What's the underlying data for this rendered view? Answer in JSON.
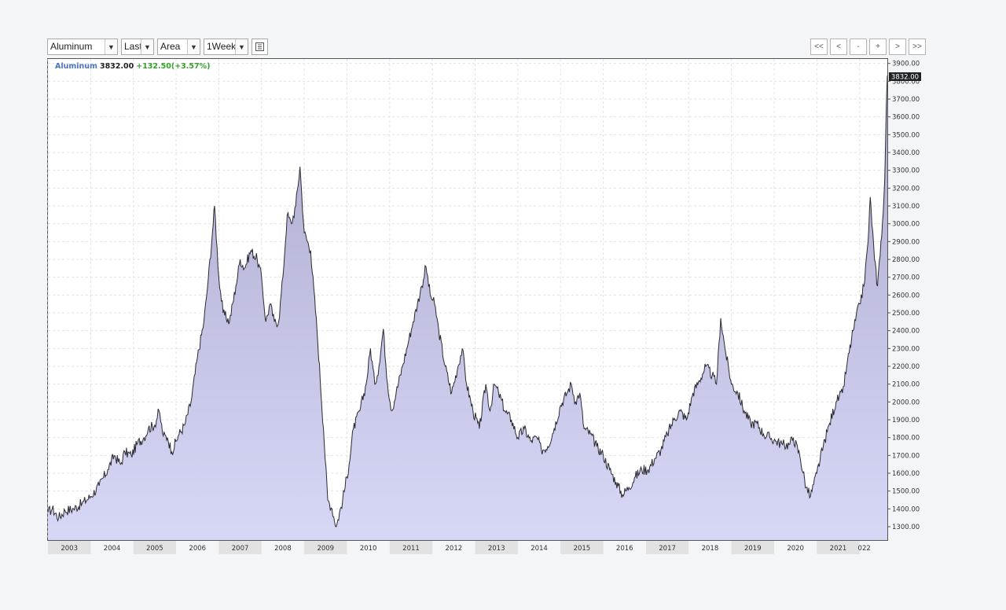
{
  "toolbar": {
    "symbol": "Aluminum",
    "price_type": "Last",
    "chart_style": "Area",
    "interval": "1Week",
    "settings_icon": "grid-settings-icon"
  },
  "navigation": {
    "first": "<<",
    "prev": "<",
    "zoom_out": "-",
    "zoom_in": "+",
    "next": ">",
    "last": ">>"
  },
  "legend": {
    "name": "Aluminum",
    "last": "3832.00",
    "change": "+132.50(+3.57%)"
  },
  "price_tag": "3832.00",
  "colors": {
    "area_top": "#abaacc",
    "area_bottom": "#d7d7f6",
    "line": "#2a2a33",
    "name": "#4a73c4",
    "change": "#33a02c",
    "grid": "#e3e3e3"
  },
  "chart_data": {
    "type": "area",
    "title": "Aluminum",
    "ylim": [
      1225,
      3925
    ],
    "yticks": [
      "1300.00",
      "1400.00",
      "1500.00",
      "1600.00",
      "1700.00",
      "1800.00",
      "1900.00",
      "2000.00",
      "2100.00",
      "2200.00",
      "2300.00",
      "2400.00",
      "2500.00",
      "2600.00",
      "2700.00",
      "2800.00",
      "2900.00",
      "3000.00",
      "3100.00",
      "3200.00",
      "3300.00",
      "3400.00",
      "3500.00",
      "3600.00",
      "3700.00",
      "3800.00",
      "3900.00"
    ],
    "xlabels": [
      "2003",
      "2004",
      "2005",
      "2006",
      "2007",
      "2008",
      "2009",
      "2010",
      "2011",
      "2012",
      "2013",
      "2014",
      "2015",
      "2016",
      "2017",
      "2018",
      "2019",
      "2020",
      "2021",
      "022"
    ],
    "xlim": [
      2002.5,
      2022.15
    ],
    "series": [
      {
        "name": "Aluminum",
        "points": [
          [
            2002.5,
            1380
          ],
          [
            2002.6,
            1400
          ],
          [
            2002.75,
            1350
          ],
          [
            2002.9,
            1390
          ],
          [
            2003.1,
            1400
          ],
          [
            2003.3,
            1430
          ],
          [
            2003.5,
            1470
          ],
          [
            2003.7,
            1530
          ],
          [
            2003.9,
            1620
          ],
          [
            2004.05,
            1700
          ],
          [
            2004.2,
            1650
          ],
          [
            2004.3,
            1720
          ],
          [
            2004.45,
            1700
          ],
          [
            2004.6,
            1770
          ],
          [
            2004.75,
            1800
          ],
          [
            2004.85,
            1850
          ],
          [
            2005.0,
            1870
          ],
          [
            2005.1,
            1950
          ],
          [
            2005.2,
            1810
          ],
          [
            2005.3,
            1800
          ],
          [
            2005.4,
            1720
          ],
          [
            2005.55,
            1810
          ],
          [
            2005.7,
            1870
          ],
          [
            2005.85,
            2000
          ],
          [
            2006.0,
            2250
          ],
          [
            2006.15,
            2450
          ],
          [
            2006.25,
            2680
          ],
          [
            2006.35,
            2950
          ],
          [
            2006.4,
            3100
          ],
          [
            2006.5,
            2700
          ],
          [
            2006.6,
            2500
          ],
          [
            2006.75,
            2450
          ],
          [
            2006.9,
            2650
          ],
          [
            2007.0,
            2800
          ],
          [
            2007.1,
            2750
          ],
          [
            2007.25,
            2850
          ],
          [
            2007.4,
            2800
          ],
          [
            2007.5,
            2700
          ],
          [
            2007.6,
            2450
          ],
          [
            2007.7,
            2550
          ],
          [
            2007.8,
            2450
          ],
          [
            2007.9,
            2450
          ],
          [
            2008.0,
            2700
          ],
          [
            2008.1,
            3050
          ],
          [
            2008.2,
            3000
          ],
          [
            2008.3,
            3100
          ],
          [
            2008.4,
            3320
          ],
          [
            2008.5,
            2950
          ],
          [
            2008.65,
            2850
          ],
          [
            2008.8,
            2400
          ],
          [
            2008.95,
            1850
          ],
          [
            2009.05,
            1450
          ],
          [
            2009.15,
            1400
          ],
          [
            2009.25,
            1300
          ],
          [
            2009.4,
            1450
          ],
          [
            2009.55,
            1650
          ],
          [
            2009.65,
            1850
          ],
          [
            2009.8,
            1950
          ],
          [
            2009.95,
            2100
          ],
          [
            2010.05,
            2300
          ],
          [
            2010.15,
            2100
          ],
          [
            2010.25,
            2200
          ],
          [
            2010.35,
            2410
          ],
          [
            2010.45,
            2100
          ],
          [
            2010.55,
            1950
          ],
          [
            2010.65,
            2050
          ],
          [
            2010.8,
            2200
          ],
          [
            2010.95,
            2350
          ],
          [
            2011.05,
            2450
          ],
          [
            2011.15,
            2550
          ],
          [
            2011.25,
            2650
          ],
          [
            2011.35,
            2760
          ],
          [
            2011.45,
            2600
          ],
          [
            2011.55,
            2550
          ],
          [
            2011.65,
            2400
          ],
          [
            2011.8,
            2200
          ],
          [
            2011.95,
            2050
          ],
          [
            2012.1,
            2200
          ],
          [
            2012.2,
            2300
          ],
          [
            2012.3,
            2100
          ],
          [
            2012.45,
            1950
          ],
          [
            2012.6,
            1850
          ],
          [
            2012.75,
            2100
          ],
          [
            2012.85,
            1950
          ],
          [
            2012.95,
            2100
          ],
          [
            2013.05,
            2050
          ],
          [
            2013.2,
            1950
          ],
          [
            2013.35,
            1900
          ],
          [
            2013.5,
            1800
          ],
          [
            2013.65,
            1850
          ],
          [
            2013.8,
            1780
          ],
          [
            2013.95,
            1800
          ],
          [
            2014.05,
            1730
          ],
          [
            2014.2,
            1750
          ],
          [
            2014.35,
            1850
          ],
          [
            2014.5,
            1980
          ],
          [
            2014.65,
            2050
          ],
          [
            2014.75,
            2100
          ],
          [
            2014.85,
            2000
          ],
          [
            2014.95,
            2050
          ],
          [
            2015.05,
            1850
          ],
          [
            2015.2,
            1820
          ],
          [
            2015.35,
            1750
          ],
          [
            2015.5,
            1700
          ],
          [
            2015.65,
            1620
          ],
          [
            2015.8,
            1550
          ],
          [
            2015.95,
            1480
          ],
          [
            2016.1,
            1520
          ],
          [
            2016.25,
            1580
          ],
          [
            2016.4,
            1620
          ],
          [
            2016.55,
            1620
          ],
          [
            2016.7,
            1680
          ],
          [
            2016.85,
            1730
          ],
          [
            2017.0,
            1820
          ],
          [
            2017.15,
            1900
          ],
          [
            2017.3,
            1950
          ],
          [
            2017.45,
            1900
          ],
          [
            2017.6,
            2050
          ],
          [
            2017.75,
            2120
          ],
          [
            2017.9,
            2200
          ],
          [
            2018.05,
            2150
          ],
          [
            2018.15,
            2100
          ],
          [
            2018.25,
            2470
          ],
          [
            2018.35,
            2300
          ],
          [
            2018.5,
            2100
          ],
          [
            2018.65,
            2050
          ],
          [
            2018.8,
            1950
          ],
          [
            2018.95,
            1880
          ],
          [
            2019.1,
            1880
          ],
          [
            2019.25,
            1820
          ],
          [
            2019.4,
            1800
          ],
          [
            2019.55,
            1780
          ],
          [
            2019.7,
            1760
          ],
          [
            2019.85,
            1760
          ],
          [
            2019.95,
            1800
          ],
          [
            2020.1,
            1700
          ],
          [
            2020.25,
            1520
          ],
          [
            2020.35,
            1470
          ],
          [
            2020.5,
            1600
          ],
          [
            2020.65,
            1750
          ],
          [
            2020.8,
            1880
          ],
          [
            2020.95,
            2000
          ],
          [
            2021.1,
            2050
          ],
          [
            2021.2,
            2200
          ],
          [
            2021.35,
            2400
          ],
          [
            2021.5,
            2550
          ],
          [
            2021.6,
            2650
          ],
          [
            2021.7,
            2900
          ],
          [
            2021.75,
            3150
          ],
          [
            2021.85,
            2800
          ],
          [
            2021.92,
            2650
          ],
          [
            2022.0,
            2900
          ],
          [
            2022.05,
            3050
          ],
          [
            2022.09,
            3250
          ],
          [
            2022.12,
            3600
          ],
          [
            2022.15,
            3832
          ]
        ]
      }
    ]
  }
}
